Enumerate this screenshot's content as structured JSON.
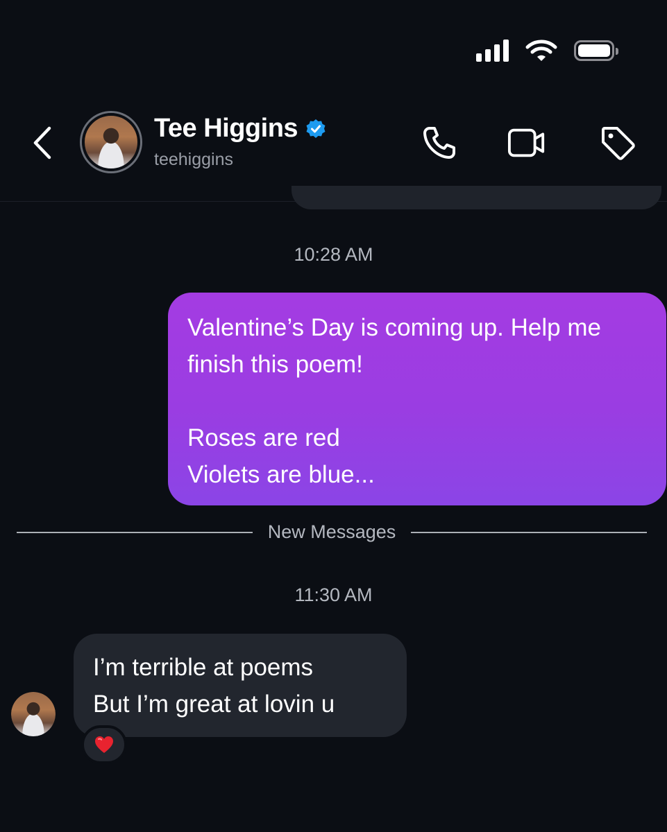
{
  "status_bar": {
    "signal_icon": "cellular-signal-icon",
    "wifi_icon": "wifi-icon",
    "battery_icon": "battery-icon"
  },
  "header": {
    "back_icon": "chevron-left-icon",
    "contact_name": "Tee Higgins",
    "contact_handle": "teehiggins",
    "verified_icon": "verified-badge-icon",
    "verified_color": "#1d9bf0",
    "actions": [
      {
        "name": "call-button",
        "icon": "phone-icon"
      },
      {
        "name": "video-call-button",
        "icon": "video-camera-icon"
      },
      {
        "name": "label-button",
        "icon": "tag-icon"
      }
    ]
  },
  "conversation": {
    "timestamp_1": "10:28 AM",
    "sent_message": {
      "lines": [
        "Valentine’s Day is coming up. Help me finish this poem!",
        "",
        "Roses are red",
        "Violets are blue..."
      ],
      "color_top": "#a43ce2",
      "color_bottom": "#8b45e6"
    },
    "divider_label": "New Messages",
    "timestamp_2": "11:30 AM",
    "received_message": {
      "lines": [
        "I’m terrible at poems",
        "But I’m great at lovin u"
      ],
      "reaction": "❤️",
      "reaction_icon": "heart-icon"
    }
  },
  "colors": {
    "background": "#0b0e14",
    "received_bubble": "#22262e",
    "secondary_text": "#9a9ea7"
  }
}
